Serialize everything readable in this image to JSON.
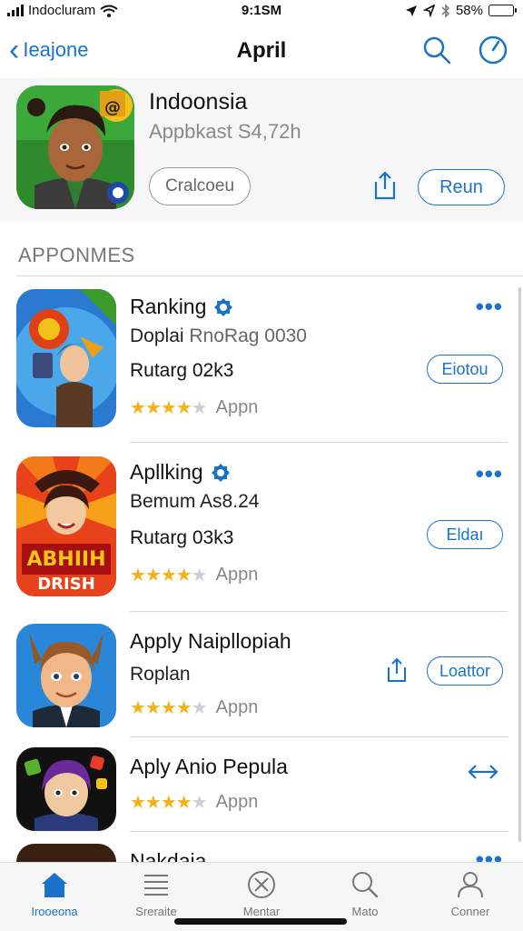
{
  "status_bar": {
    "carrier": "Indocluram",
    "time": "9:1SM",
    "battery": "58%",
    "battery_level": 0.58
  },
  "nav": {
    "back_label": "Ieajone",
    "title": "April",
    "search_icon": "search-icon",
    "compass_icon": "compass-icon"
  },
  "header": {
    "title": "Indoonsia",
    "subtitle": "Appbkast S4,72h",
    "secondary_button": "Cralcoeu",
    "primary_button": "Reun",
    "share_icon": "share-icon"
  },
  "section": {
    "title": "APPONMES"
  },
  "apps": [
    {
      "name": "Ranking",
      "verified": true,
      "line2_a": "Doplai",
      "line2_b": "RnoRag 0030",
      "line3": "Rutarg 02k3",
      "rating": 3.5,
      "rating_label": "Appn",
      "button": "Eiotou",
      "has_more": true
    },
    {
      "name": "Apllking",
      "verified": true,
      "line2_a": "Bemum",
      "line2_b": "As8.24",
      "line3": "Rutarg 03k3",
      "rating": 3.5,
      "rating_label": "Appn",
      "button": "Eldaı",
      "has_more": true,
      "icon_text_1": "ABHIIH",
      "icon_text_2": "DRISH"
    },
    {
      "name": "Apply Naipllopiah",
      "verified": false,
      "line2_a": "Roplan",
      "line2_b": "",
      "line3": "",
      "rating": 3.5,
      "rating_label": "Appn",
      "button": "Loattor",
      "has_more": false
    },
    {
      "name": "Aply Anio Pepula",
      "verified": false,
      "line2_a": "",
      "line2_b": "",
      "line3": "",
      "rating": 3.5,
      "rating_label": "Appn",
      "button": "",
      "has_more": false
    },
    {
      "name": "Nakdaia",
      "verified": true,
      "has_more": true
    }
  ],
  "tabs": [
    {
      "label": "Irooeona",
      "icon": "home-icon",
      "active": true
    },
    {
      "label": "Sreraite",
      "icon": "list-icon",
      "active": false
    },
    {
      "label": "Mentar",
      "icon": "explore-icon",
      "active": false
    },
    {
      "label": "Mato",
      "icon": "search-icon",
      "active": false
    },
    {
      "label": "Conner",
      "icon": "person-icon",
      "active": false
    }
  ],
  "colors": {
    "accent": "#1a73c8",
    "star": "#f2b21b",
    "muted": "#777777",
    "header_bg": "#f6f6f6"
  }
}
